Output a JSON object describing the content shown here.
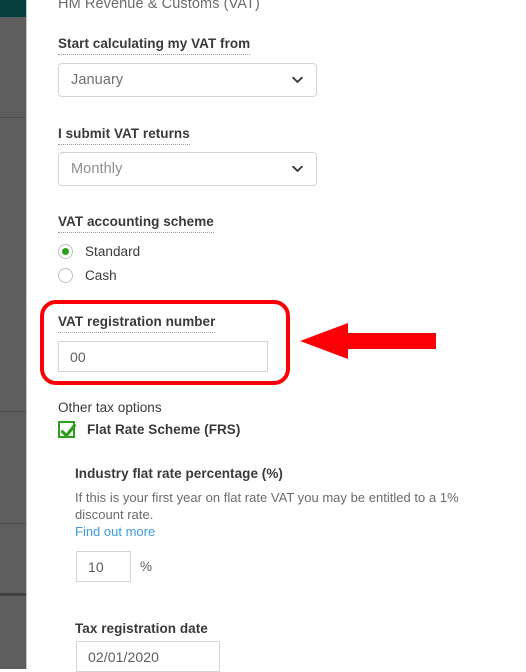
{
  "window": {
    "accent_teal": "#043f3e",
    "sidebar_gray": "#5e5e5e",
    "brand_green": "#2ca01c",
    "link_blue": "#3d9ae0",
    "annotation_red": "#fb0007"
  },
  "sidebar": {
    "name": "app-navigation-rail",
    "collapsed": true,
    "items": []
  },
  "form": {
    "section_title": "HM Revenue & Customs (VAT)",
    "start_calculating": {
      "label": "Start calculating my VAT from",
      "value": "January",
      "icon": "chevron-down-icon"
    },
    "submit_returns": {
      "label": "I submit VAT returns",
      "value": "Monthly",
      "icon": "chevron-down-icon"
    },
    "accounting_scheme": {
      "label": "VAT accounting scheme",
      "options": [
        {
          "label": "Standard",
          "selected": true
        },
        {
          "label": "Cash",
          "selected": false
        }
      ]
    },
    "registration_number": {
      "label": "VAT registration number",
      "value": "00",
      "placeholder": ""
    },
    "other_tax_options": {
      "label": "Other tax options",
      "flat_rate_scheme": {
        "label": "Flat Rate Scheme (FRS)",
        "checked": true,
        "icon": "checkmark-icon"
      }
    },
    "industry_flat_rate": {
      "label": "Industry flat rate percentage (%)",
      "help_text": "If this is your first year on flat rate VAT you may be entitled to a 1% discount rate.",
      "link_text": "Find out more",
      "value": "10",
      "unit": "%"
    },
    "tax_registration_date": {
      "label": "Tax registration date",
      "value": "02/01/2020"
    }
  },
  "annotation": {
    "highlight_target": "VAT registration number",
    "shape": "rounded-rectangle",
    "arrow_direction": "left",
    "color": "#fb0007"
  }
}
